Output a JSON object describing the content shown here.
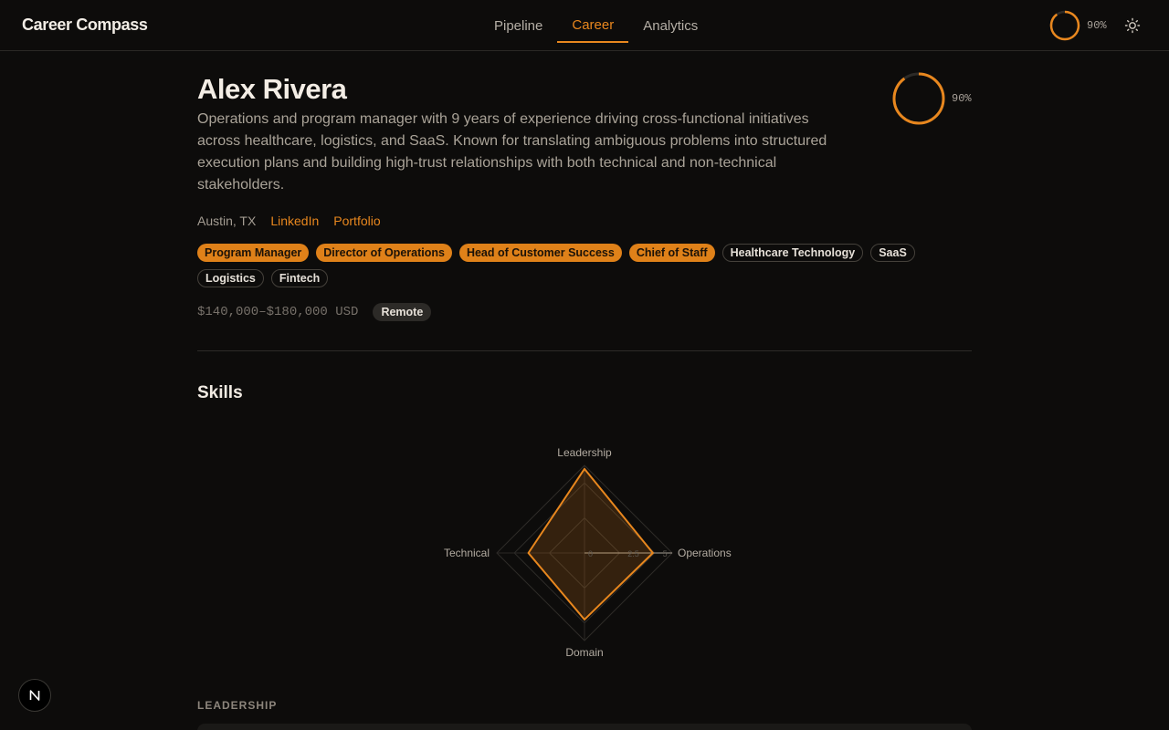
{
  "app": {
    "title": "Career Compass"
  },
  "nav": {
    "tabs": [
      {
        "label": "Pipeline"
      },
      {
        "label": "Career",
        "active": true
      },
      {
        "label": "Analytics"
      }
    ]
  },
  "header": {
    "completeness_pct": 90,
    "completeness_label": "90%",
    "theme_icon": "sun-icon"
  },
  "profile": {
    "name": "Alex Rivera",
    "bio": "Operations and program manager with 9 years of experience driving cross-functional initiatives across healthcare, logistics, and SaaS. Known for translating ambiguous problems into structured execution plans and building high-trust relationships with both technical and non-technical stakeholders.",
    "completeness_pct": 90,
    "completeness_label": "90%",
    "location": "Austin, TX",
    "links": {
      "linkedin": "LinkedIn",
      "portfolio": "Portfolio"
    },
    "target_roles": [
      "Program Manager",
      "Director of Operations",
      "Head of Customer Success",
      "Chief of Staff"
    ],
    "industries": [
      "Healthcare Technology",
      "SaaS",
      "Logistics",
      "Fintech"
    ],
    "salary": "$140,000–$180,000 USD",
    "work_mode": "Remote"
  },
  "skills": {
    "title": "Skills",
    "radar": {
      "axes": [
        "Leadership",
        "Operations",
        "Domain",
        "Technical"
      ],
      "values": [
        4.8,
        3.9,
        3.8,
        3.2
      ],
      "max": 5,
      "tick_labels": [
        "0",
        "2.5",
        "5"
      ]
    }
  },
  "sections": {
    "leadership": "LEADERSHIP"
  },
  "colors": {
    "accent": "#e8871e",
    "background": "#0d0c0b"
  }
}
